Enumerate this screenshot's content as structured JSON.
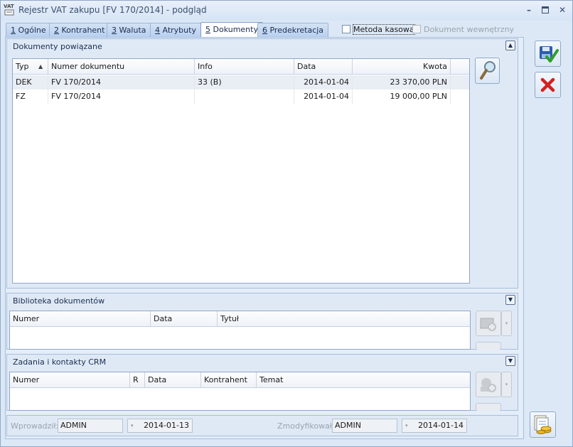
{
  "window": {
    "icon_text": "VAT",
    "title": "Rejestr VAT zakupu [FV 170/2014] - podgląd"
  },
  "tabs": [
    {
      "key": "1",
      "label": " Ogólne"
    },
    {
      "key": "2",
      "label": " Kontrahent"
    },
    {
      "key": "3",
      "label": " Waluta"
    },
    {
      "key": "4",
      "label": " Atrybuty"
    },
    {
      "key": "5",
      "label": " Dokumenty"
    },
    {
      "key": "6",
      "label": " Predekretacja"
    }
  ],
  "options": {
    "metoda_kasowa": "Metoda kasowa",
    "dokument_wewnetrzny": "Dokument wewnętrzny"
  },
  "related_docs": {
    "title": "Dokumenty powiązane",
    "columns": [
      "Typ",
      "Numer dokumentu",
      "Info",
      "Data",
      "Kwota"
    ],
    "sort_indicator": "▲",
    "rows": [
      {
        "typ": "DEK",
        "numer": "FV 170/2014",
        "info": "33 (B)",
        "data": "2014-01-04",
        "kwota": "23 370,00 PLN"
      },
      {
        "typ": "FZ",
        "numer": "FV 170/2014",
        "info": "",
        "data": "2014-01-04",
        "kwota": "19 000,00 PLN"
      }
    ]
  },
  "library": {
    "title": "Biblioteka dokumentów",
    "columns": [
      "Numer",
      "Data",
      "Tytuł"
    ]
  },
  "crm": {
    "title": "Zadania i kontakty CRM",
    "columns": [
      "Numer",
      "R",
      "Data",
      "Kontrahent",
      "Temat"
    ]
  },
  "footer": {
    "entered_label": "Wprowadził:",
    "entered_by": "ADMIN",
    "entered_date": "2014-01-13",
    "modified_label": "Zmodyfikował:",
    "modified_by": "ADMIN",
    "modified_date": "2014-01-14"
  },
  "colors": {
    "save_icon": "#2a5db0",
    "check_green": "#2e9e2e",
    "cancel_red": "#d42020"
  }
}
